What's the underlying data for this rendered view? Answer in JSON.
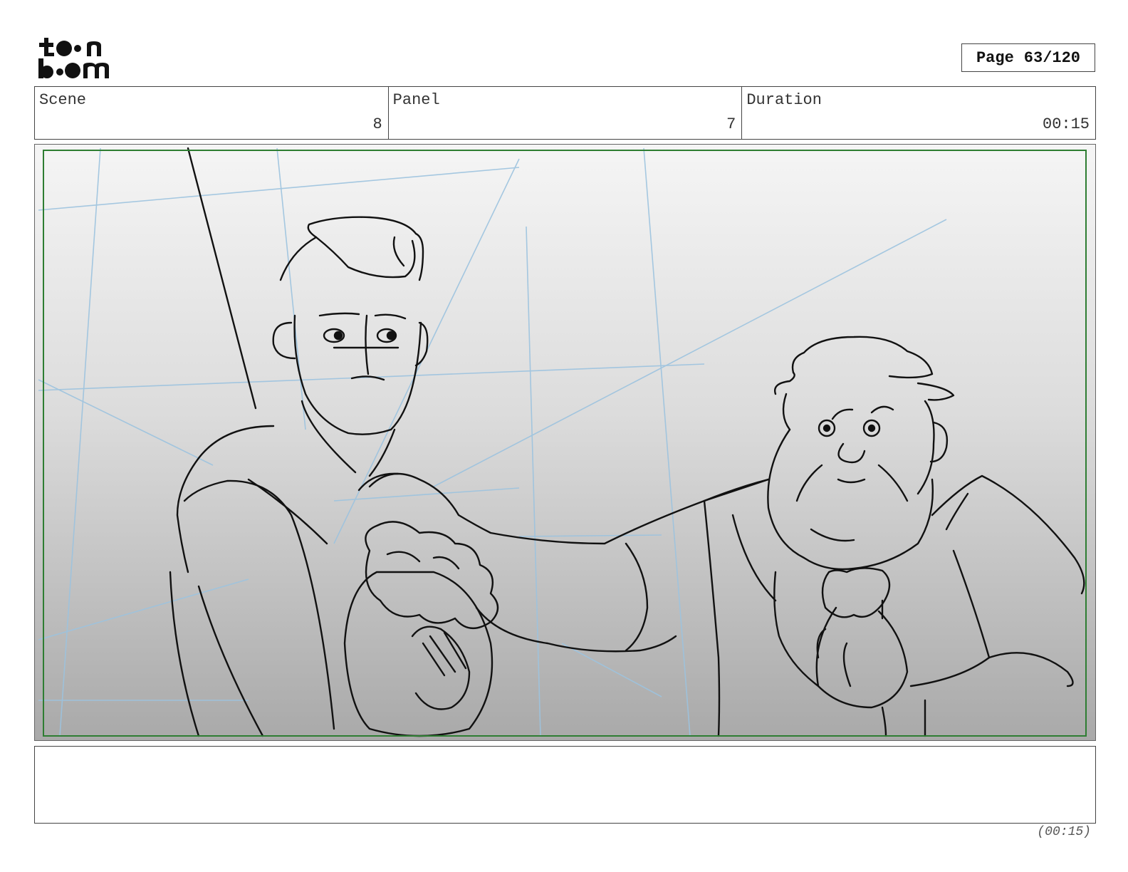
{
  "brand": {
    "logo_text": "toon boom"
  },
  "page": {
    "label": "Page",
    "number": "63/120"
  },
  "info": {
    "scene_label": "Scene",
    "scene_value": "8",
    "panel_label": "Panel",
    "panel_value": "7",
    "duration_label": "Duration",
    "duration_value": "00:15"
  },
  "panel": {
    "image_name": "storyboard-sketch",
    "safe_frame_color": "#2e7d32"
  },
  "notes": {
    "text": ""
  },
  "footer": {
    "duration": "(00:15)"
  }
}
